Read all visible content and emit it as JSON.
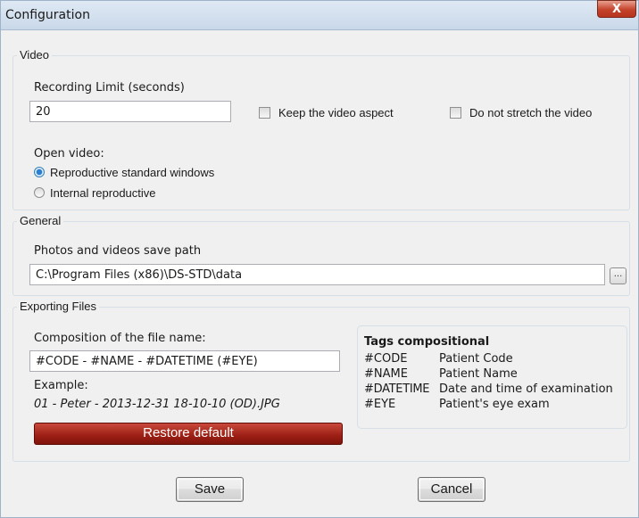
{
  "window": {
    "title": "Configuration",
    "close_glyph": "X"
  },
  "video": {
    "group_title": "Video",
    "recording_limit_label": "Recording Limit (seconds)",
    "recording_limit_value": "20",
    "keep_aspect_label": "Keep the video aspect",
    "keep_aspect_checked": false,
    "no_stretch_label": "Do not stretch the video",
    "no_stretch_checked": false,
    "open_video_label": "Open video:",
    "options": [
      {
        "label": "Reproductive standard windows",
        "selected": true
      },
      {
        "label": "Internal reproductive",
        "selected": false
      }
    ]
  },
  "general": {
    "group_title": "General",
    "save_path_label": "Photos and videos save path",
    "save_path_value": "C:\\Program Files (x86)\\DS-STD\\data",
    "browse_label": "..."
  },
  "exporting": {
    "group_title": "Exporting Files",
    "composition_label": "Composition of the file name:",
    "composition_value": "#CODE - #NAME - #DATETIME (#EYE)",
    "example_label": "Example:",
    "example_value": "01 - Peter - 2013-12-31 18-10-10 (OD).JPG",
    "restore_label": "Restore default",
    "tags": {
      "title": "Tags compositional",
      "rows": [
        {
          "tag": "#CODE",
          "desc": "Patient Code"
        },
        {
          "tag": "#NAME",
          "desc": "Patient Name"
        },
        {
          "tag": "#DATETIME",
          "desc": "Date and time of examination"
        },
        {
          "tag": "#EYE",
          "desc": "Patient's eye exam"
        }
      ]
    }
  },
  "footer": {
    "save_label": "Save",
    "cancel_label": "Cancel"
  },
  "colors": {
    "title_bar": "#c9d8e9",
    "close_button": "#c4432b",
    "restore_button": "#9c1e14",
    "dialog_bg": "#f0f0f0"
  },
  "icons": {
    "close": "close-icon",
    "browse": "ellipsis-icon"
  }
}
